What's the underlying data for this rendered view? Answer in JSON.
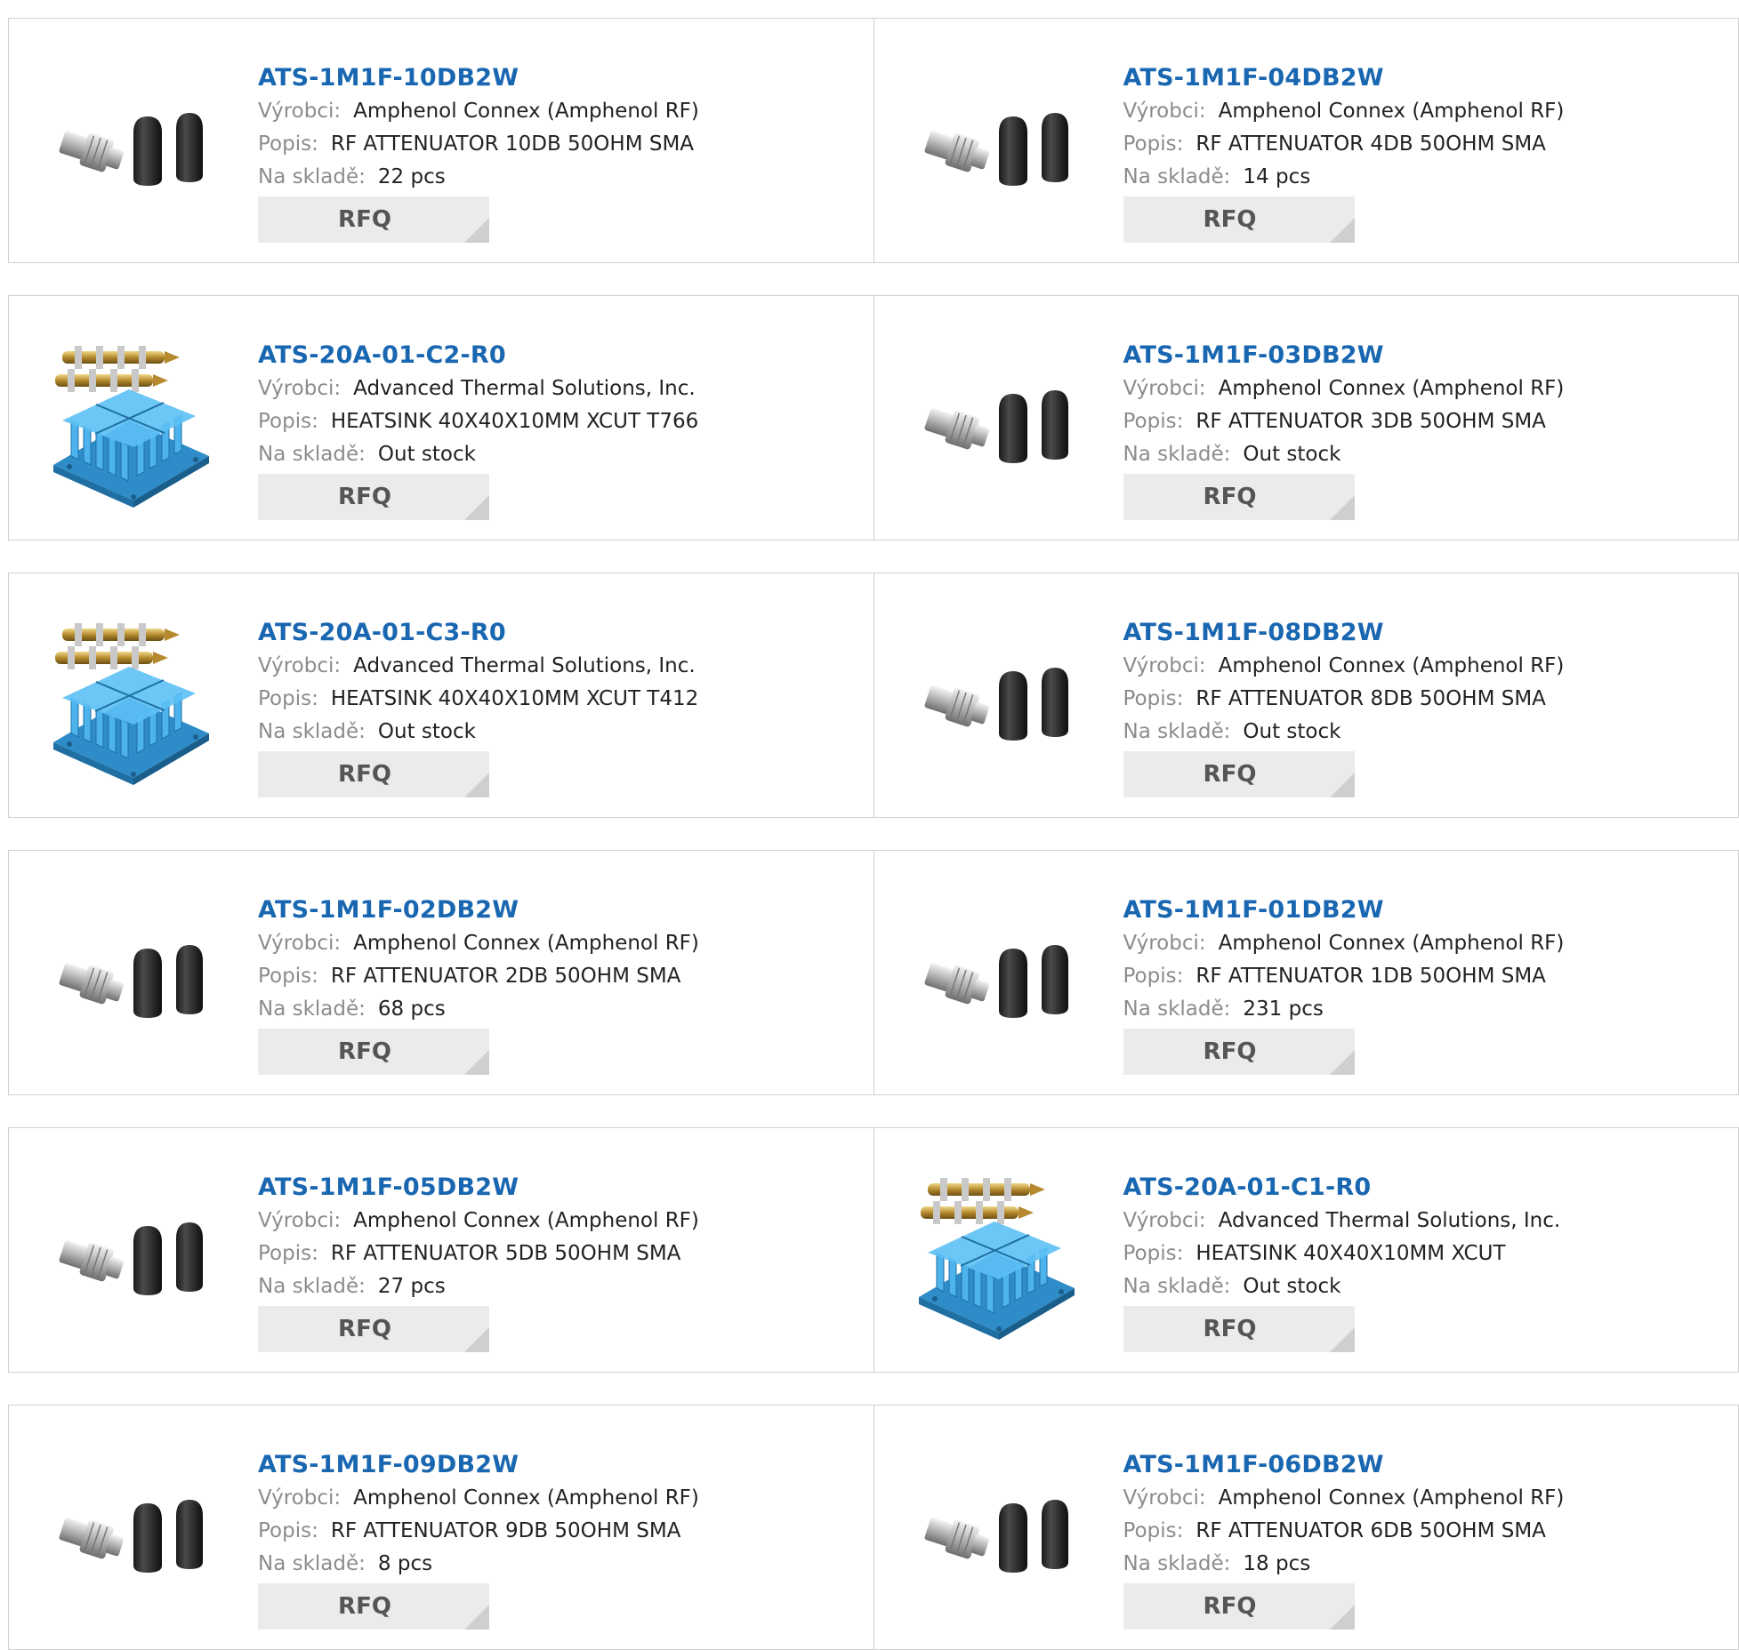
{
  "labels": {
    "manufacturer": "Výrobci:",
    "description": "Popis:",
    "stock": "Na skladě:",
    "rfq": "RFQ"
  },
  "products": [
    {
      "part": "ATS-1M1F-10DB2W",
      "manufacturer": "Amphenol Connex (Amphenol RF)",
      "description": "RF ATTENUATOR 10DB 50OHM SMA",
      "stock": "22 pcs",
      "image": "rf-attenuator"
    },
    {
      "part": "ATS-1M1F-04DB2W",
      "manufacturer": "Amphenol Connex (Amphenol RF)",
      "description": "RF ATTENUATOR 4DB 50OHM SMA",
      "stock": "14 pcs",
      "image": "rf-attenuator"
    },
    {
      "part": "ATS-20A-01-C2-R0",
      "manufacturer": "Advanced Thermal Solutions, Inc.",
      "description": "HEATSINK 40X40X10MM XCUT T766",
      "stock": "Out stock",
      "image": "heatsink"
    },
    {
      "part": "ATS-1M1F-03DB2W",
      "manufacturer": "Amphenol Connex (Amphenol RF)",
      "description": "RF ATTENUATOR 3DB 50OHM SMA",
      "stock": "Out stock",
      "image": "rf-attenuator"
    },
    {
      "part": "ATS-20A-01-C3-R0",
      "manufacturer": "Advanced Thermal Solutions, Inc.",
      "description": "HEATSINK 40X40X10MM XCUT T412",
      "stock": "Out stock",
      "image": "heatsink"
    },
    {
      "part": "ATS-1M1F-08DB2W",
      "manufacturer": "Amphenol Connex (Amphenol RF)",
      "description": "RF ATTENUATOR 8DB 50OHM SMA",
      "stock": "Out stock",
      "image": "rf-attenuator"
    },
    {
      "part": "ATS-1M1F-02DB2W",
      "manufacturer": "Amphenol Connex (Amphenol RF)",
      "description": "RF ATTENUATOR 2DB 50OHM SMA",
      "stock": "68 pcs",
      "image": "rf-attenuator"
    },
    {
      "part": "ATS-1M1F-01DB2W",
      "manufacturer": "Amphenol Connex (Amphenol RF)",
      "description": "RF ATTENUATOR 1DB 50OHM SMA",
      "stock": "231 pcs",
      "image": "rf-attenuator"
    },
    {
      "part": "ATS-1M1F-05DB2W",
      "manufacturer": "Amphenol Connex (Amphenol RF)",
      "description": "RF ATTENUATOR 5DB 50OHM SMA",
      "stock": "27 pcs",
      "image": "rf-attenuator"
    },
    {
      "part": "ATS-20A-01-C1-R0",
      "manufacturer": "Advanced Thermal Solutions, Inc.",
      "description": "HEATSINK 40X40X10MM XCUT",
      "stock": "Out stock",
      "image": "heatsink"
    },
    {
      "part": "ATS-1M1F-09DB2W",
      "manufacturer": "Amphenol Connex (Amphenol RF)",
      "description": "RF ATTENUATOR 9DB 50OHM SMA",
      "stock": "8 pcs",
      "image": "rf-attenuator"
    },
    {
      "part": "ATS-1M1F-06DB2W",
      "manufacturer": "Amphenol Connex (Amphenol RF)",
      "description": "RF ATTENUATOR 6DB 50OHM SMA",
      "stock": "18 pcs",
      "image": "rf-attenuator"
    }
  ],
  "colors": {
    "part_link": "#1a67b1",
    "label_gray": "#8c8c8c",
    "rfq_bg": "#ebebeb",
    "border": "#cfcfcf",
    "heatsink_blue": "#3aa0dd"
  }
}
